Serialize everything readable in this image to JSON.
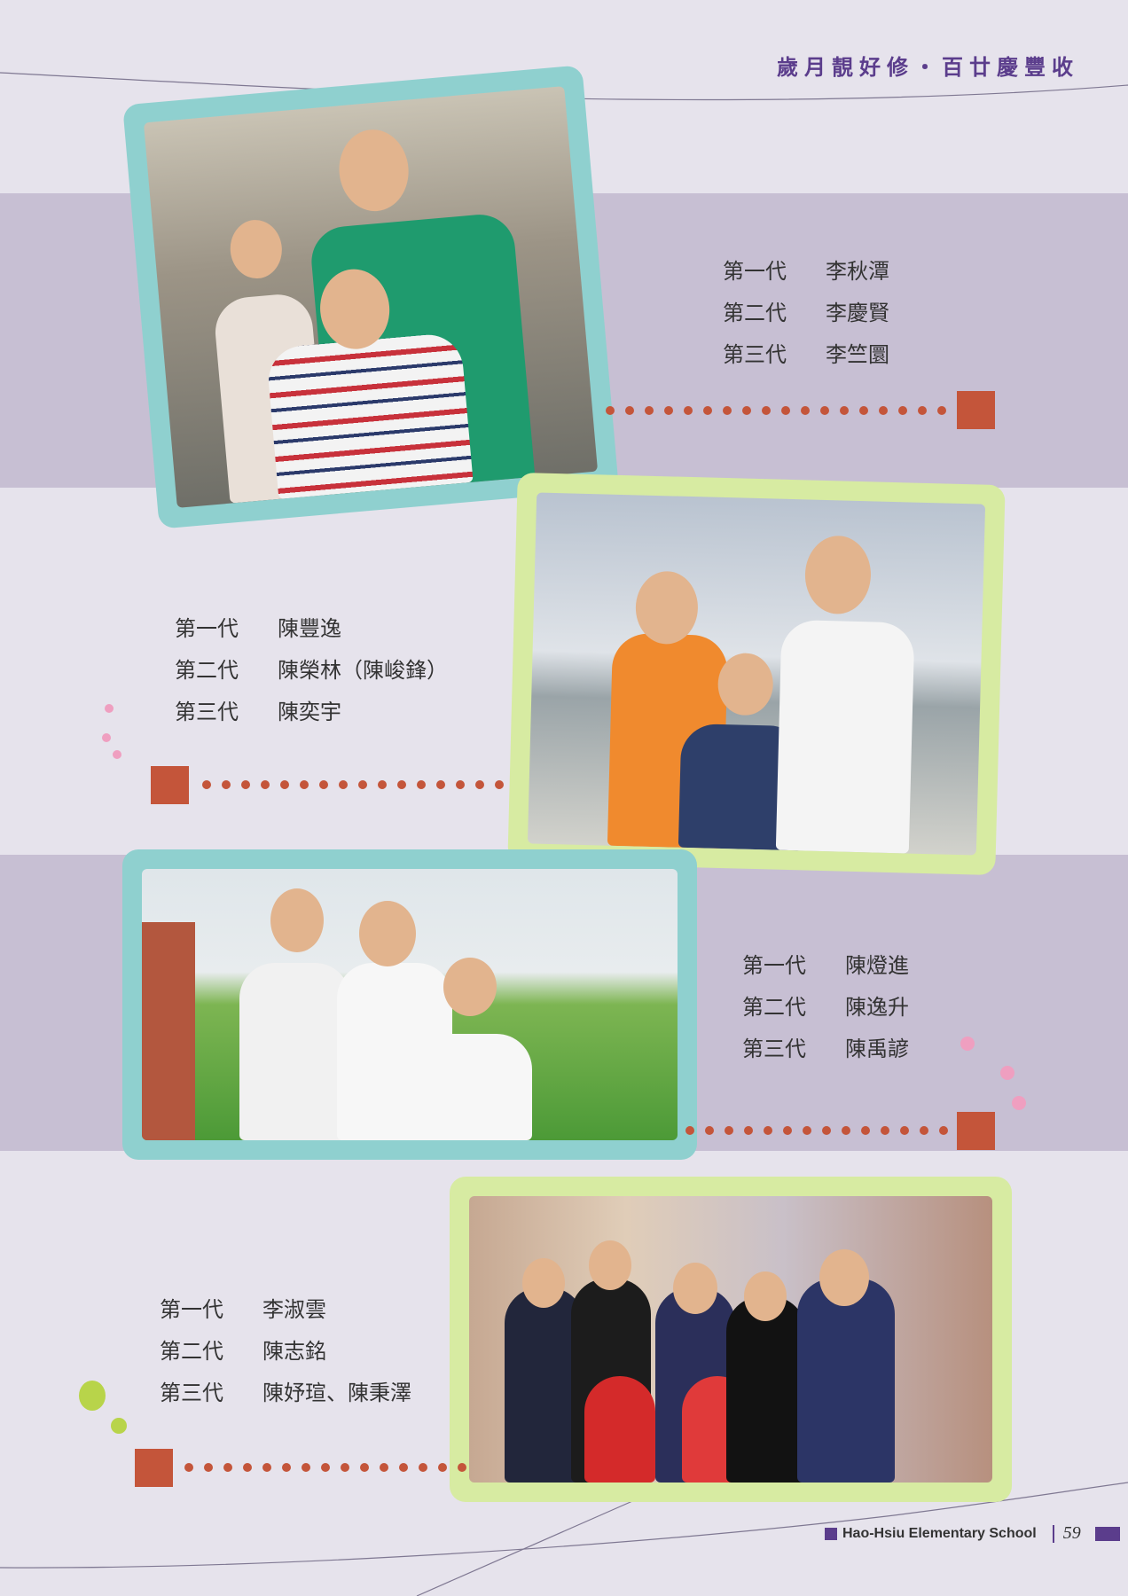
{
  "header": {
    "title": "歲月靚好修・百廿慶豐收"
  },
  "families": [
    {
      "photo": "three-generation-family-photo-1",
      "rows": [
        {
          "gen": "第一代",
          "name": "李秋潭"
        },
        {
          "gen": "第二代",
          "name": "李慶賢"
        },
        {
          "gen": "第三代",
          "name": "李竺圜"
        }
      ]
    },
    {
      "photo": "three-generation-family-photo-2",
      "rows": [
        {
          "gen": "第一代",
          "name": "陳豐逸"
        },
        {
          "gen": "第二代",
          "name": "陳榮林（陳峻鋒）"
        },
        {
          "gen": "第三代",
          "name": "陳奕宇"
        }
      ]
    },
    {
      "photo": "three-generation-family-photo-3",
      "rows": [
        {
          "gen": "第一代",
          "name": "陳燈進"
        },
        {
          "gen": "第二代",
          "name": "陳逸升"
        },
        {
          "gen": "第三代",
          "name": "陳禹諺"
        }
      ]
    },
    {
      "photo": "three-generation-family-photo-4",
      "rows": [
        {
          "gen": "第一代",
          "name": "李淑雲"
        },
        {
          "gen": "第二代",
          "name": "陳志銘"
        },
        {
          "gen": "第三代",
          "name": "陳妤瑄、陳秉澤"
        }
      ]
    }
  ],
  "footer": {
    "school": "Hao-Hsiu Elementary School",
    "page_number": "59"
  },
  "colors": {
    "band": "#c7bfd3",
    "background": "#e6e3ec",
    "accent_purple": "#5b3d8c",
    "connector": "#c4553a",
    "frame_teal": "#8fd0cf",
    "frame_lime": "#d7eba2",
    "dot_pink": "#ef9fc0",
    "dot_green": "#b8d44a"
  }
}
